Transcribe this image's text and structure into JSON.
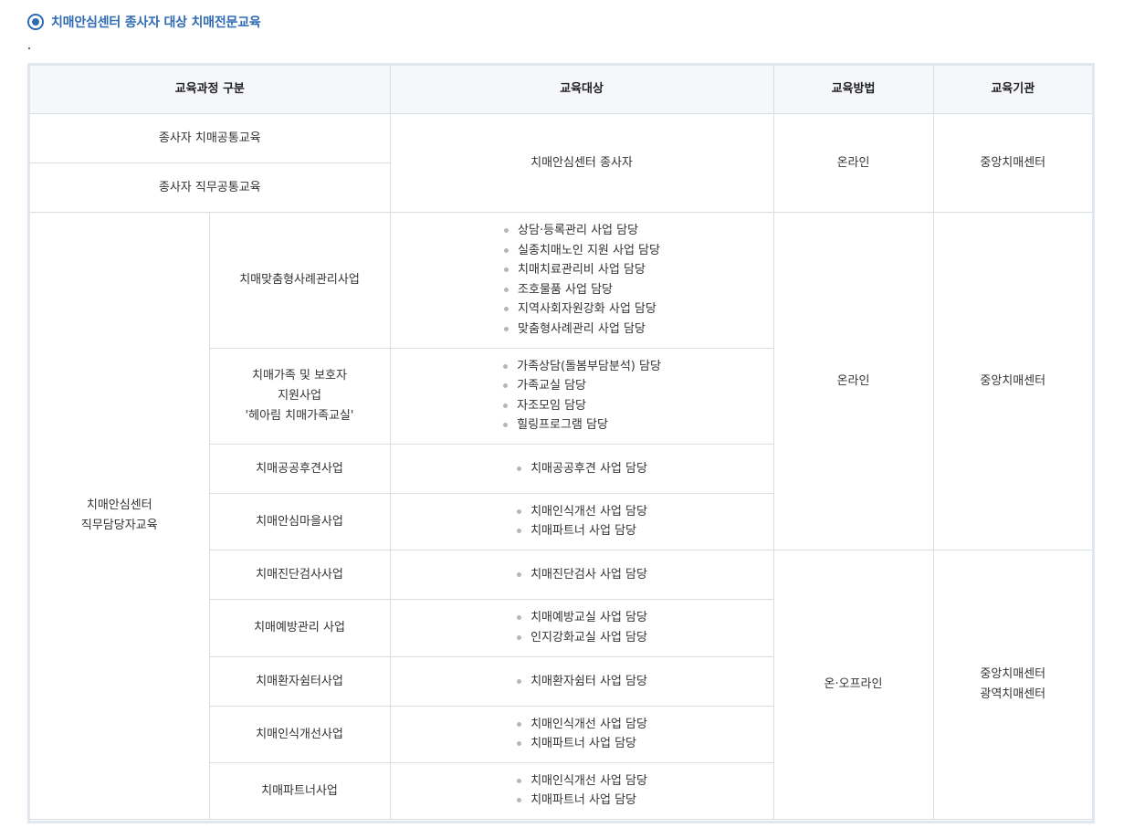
{
  "section_title": "치매안심센터 종사자 대상 치매전문교육",
  "icons": {
    "title": "radio-selected-icon",
    "bullet": "gray-bullet-icon"
  },
  "colors": {
    "accent": "#2f6bb3",
    "header_bg": "#f5f7fa",
    "border": "#d9dee5",
    "frame": "#e1e7ef"
  },
  "table": {
    "headers": [
      "교육과정 구분",
      "교육대상",
      "교육방법",
      "교육기관"
    ],
    "common": {
      "rows": [
        "종사자 치매공통교육",
        "종사자 직무공통교육"
      ],
      "target": "치매안심센터 종사자",
      "method": "온라인",
      "org": "중앙치매센터"
    },
    "job": {
      "label_line1": "치매안심센터",
      "label_line2": "직무담당자교육",
      "group1": {
        "method": "온라인",
        "org": "중앙치매센터"
      },
      "group2": {
        "method": "온·오프라인",
        "org_line1": "중앙치매센터",
        "org_line2": "광역치매센터"
      },
      "programs": [
        {
          "name": "치매맞춤형사례관리사업",
          "targets": [
            "상담·등록관리 사업 담당",
            "실종치매노인 지원 사업 담당",
            "치매치료관리비 사업 담당",
            "조호물품 사업 담당",
            "지역사회자원강화 사업 담당",
            "맞춤형사례관리 사업 담당"
          ]
        },
        {
          "name_line1": "치매가족 및 보호자",
          "name_line2": "지원사업",
          "name_line3": "'헤아림 치매가족교실'",
          "targets": [
            "가족상담(돌봄부담분석) 담당",
            "가족교실 담당",
            "자조모임 담당",
            "힐링프로그램 담당"
          ]
        },
        {
          "name": "치매공공후견사업",
          "targets": [
            "치매공공후견 사업 담당"
          ]
        },
        {
          "name": "치매안심마을사업",
          "targets": [
            "치매인식개선 사업 담당",
            "치매파트너 사업 담당"
          ]
        },
        {
          "name": "치매진단검사사업",
          "targets": [
            "치매진단검사 사업 담당"
          ]
        },
        {
          "name": "치매예방관리 사업",
          "targets": [
            "치매예방교실 사업 담당",
            "인지강화교실 사업 담당"
          ]
        },
        {
          "name": "치매환자쉼터사업",
          "targets": [
            "치매환자쉼터 사업 담당"
          ]
        },
        {
          "name": "치매인식개선사업",
          "targets": [
            "치매인식개선 사업 담당",
            "치매파트너 사업 담당"
          ]
        },
        {
          "name": "치매파트너사업",
          "targets": [
            "치매인식개선 사업 담당",
            "치매파트너 사업 담당"
          ]
        }
      ]
    }
  }
}
